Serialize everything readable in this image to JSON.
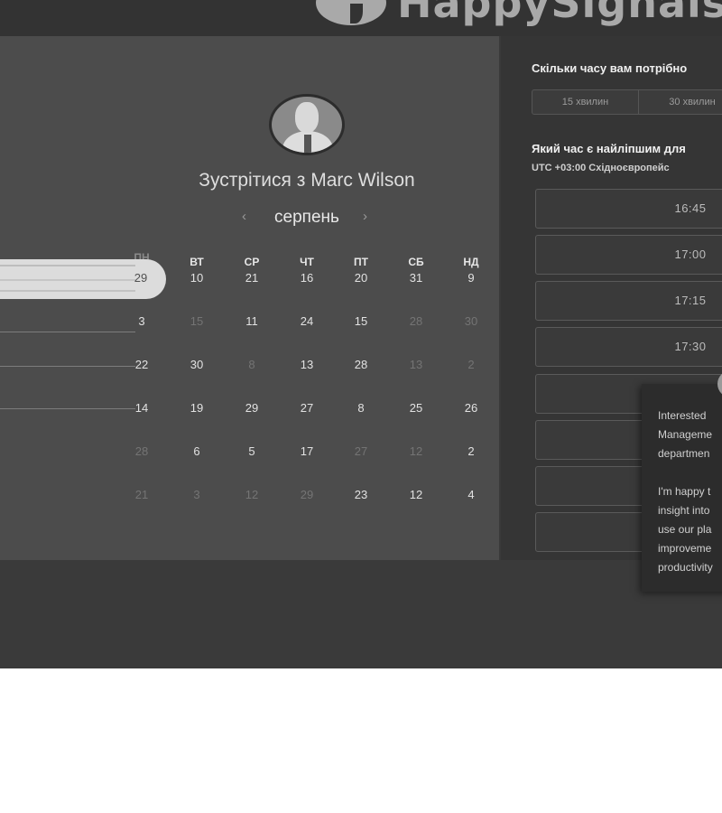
{
  "header": {
    "logo_text": "HappySignals"
  },
  "calendar": {
    "title": "Зустрітися з Marc Wilson",
    "month": "серпень",
    "prev_arrow": "‹",
    "next_arrow": "›",
    "weekdays_partial": "ПН",
    "weekdays": [
      "ВТ",
      "СР",
      "ЧТ",
      "ПТ",
      "СБ",
      "НД"
    ],
    "selected_day": "29",
    "weeks": [
      [
        {
          "d": "10",
          "c": 1
        },
        {
          "d": "21",
          "c": 1
        },
        {
          "d": "16",
          "c": 1
        },
        {
          "d": "20",
          "c": 1
        },
        {
          "d": "31",
          "c": 1
        },
        {
          "d": "9",
          "c": 1
        }
      ],
      [
        {
          "d": "3",
          "c": 1
        },
        {
          "d": "15",
          "c": 0
        },
        {
          "d": "11",
          "c": 1
        },
        {
          "d": "24",
          "c": 1
        },
        {
          "d": "15",
          "c": 1
        },
        {
          "d": "28",
          "c": 0
        },
        {
          "d": "30",
          "c": 0
        }
      ],
      [
        {
          "d": "22",
          "c": 1
        },
        {
          "d": "30",
          "c": 1
        },
        {
          "d": "8",
          "c": 0
        },
        {
          "d": "13",
          "c": 1
        },
        {
          "d": "28",
          "c": 1
        },
        {
          "d": "13",
          "c": 0
        },
        {
          "d": "2",
          "c": 0
        }
      ],
      [
        {
          "d": "14",
          "c": 1
        },
        {
          "d": "19",
          "c": 1
        },
        {
          "d": "29",
          "c": 1
        },
        {
          "d": "27",
          "c": 1
        },
        {
          "d": "8",
          "c": 1
        },
        {
          "d": "25",
          "c": 1
        },
        {
          "d": "26",
          "c": 1
        }
      ],
      [
        {
          "d": "28",
          "c": 0
        },
        {
          "d": "6",
          "c": 1
        },
        {
          "d": "5",
          "c": 1
        },
        {
          "d": "17",
          "c": 1
        },
        {
          "d": "27",
          "c": 0
        },
        {
          "d": "12",
          "c": 0
        },
        {
          "d": "2",
          "c": 1
        }
      ],
      [
        {
          "d": "21",
          "c": 0
        },
        {
          "d": "3",
          "c": 0
        },
        {
          "d": "12",
          "c": 0
        },
        {
          "d": "29",
          "c": 0
        },
        {
          "d": "23",
          "c": 1
        },
        {
          "d": "12",
          "c": 1
        },
        {
          "d": "4",
          "c": 1
        }
      ]
    ]
  },
  "booking": {
    "duration_question": "Скільки часу вам потрібно",
    "durations": [
      "15 хвилин",
      "30 хвилин"
    ],
    "time_question": "Який час є найліпшим для",
    "timezone": "UTC +03:00 Східноєвропейс",
    "slots": [
      "16:45",
      "17:00",
      "17:15",
      "17:30",
      "",
      "",
      ""
    ]
  },
  "chat": {
    "message": "Interested \nManageme\ndepartmen\n\nI'm happy t\ninsight into\nuse our pla\nimproveme\nproductivity"
  }
}
